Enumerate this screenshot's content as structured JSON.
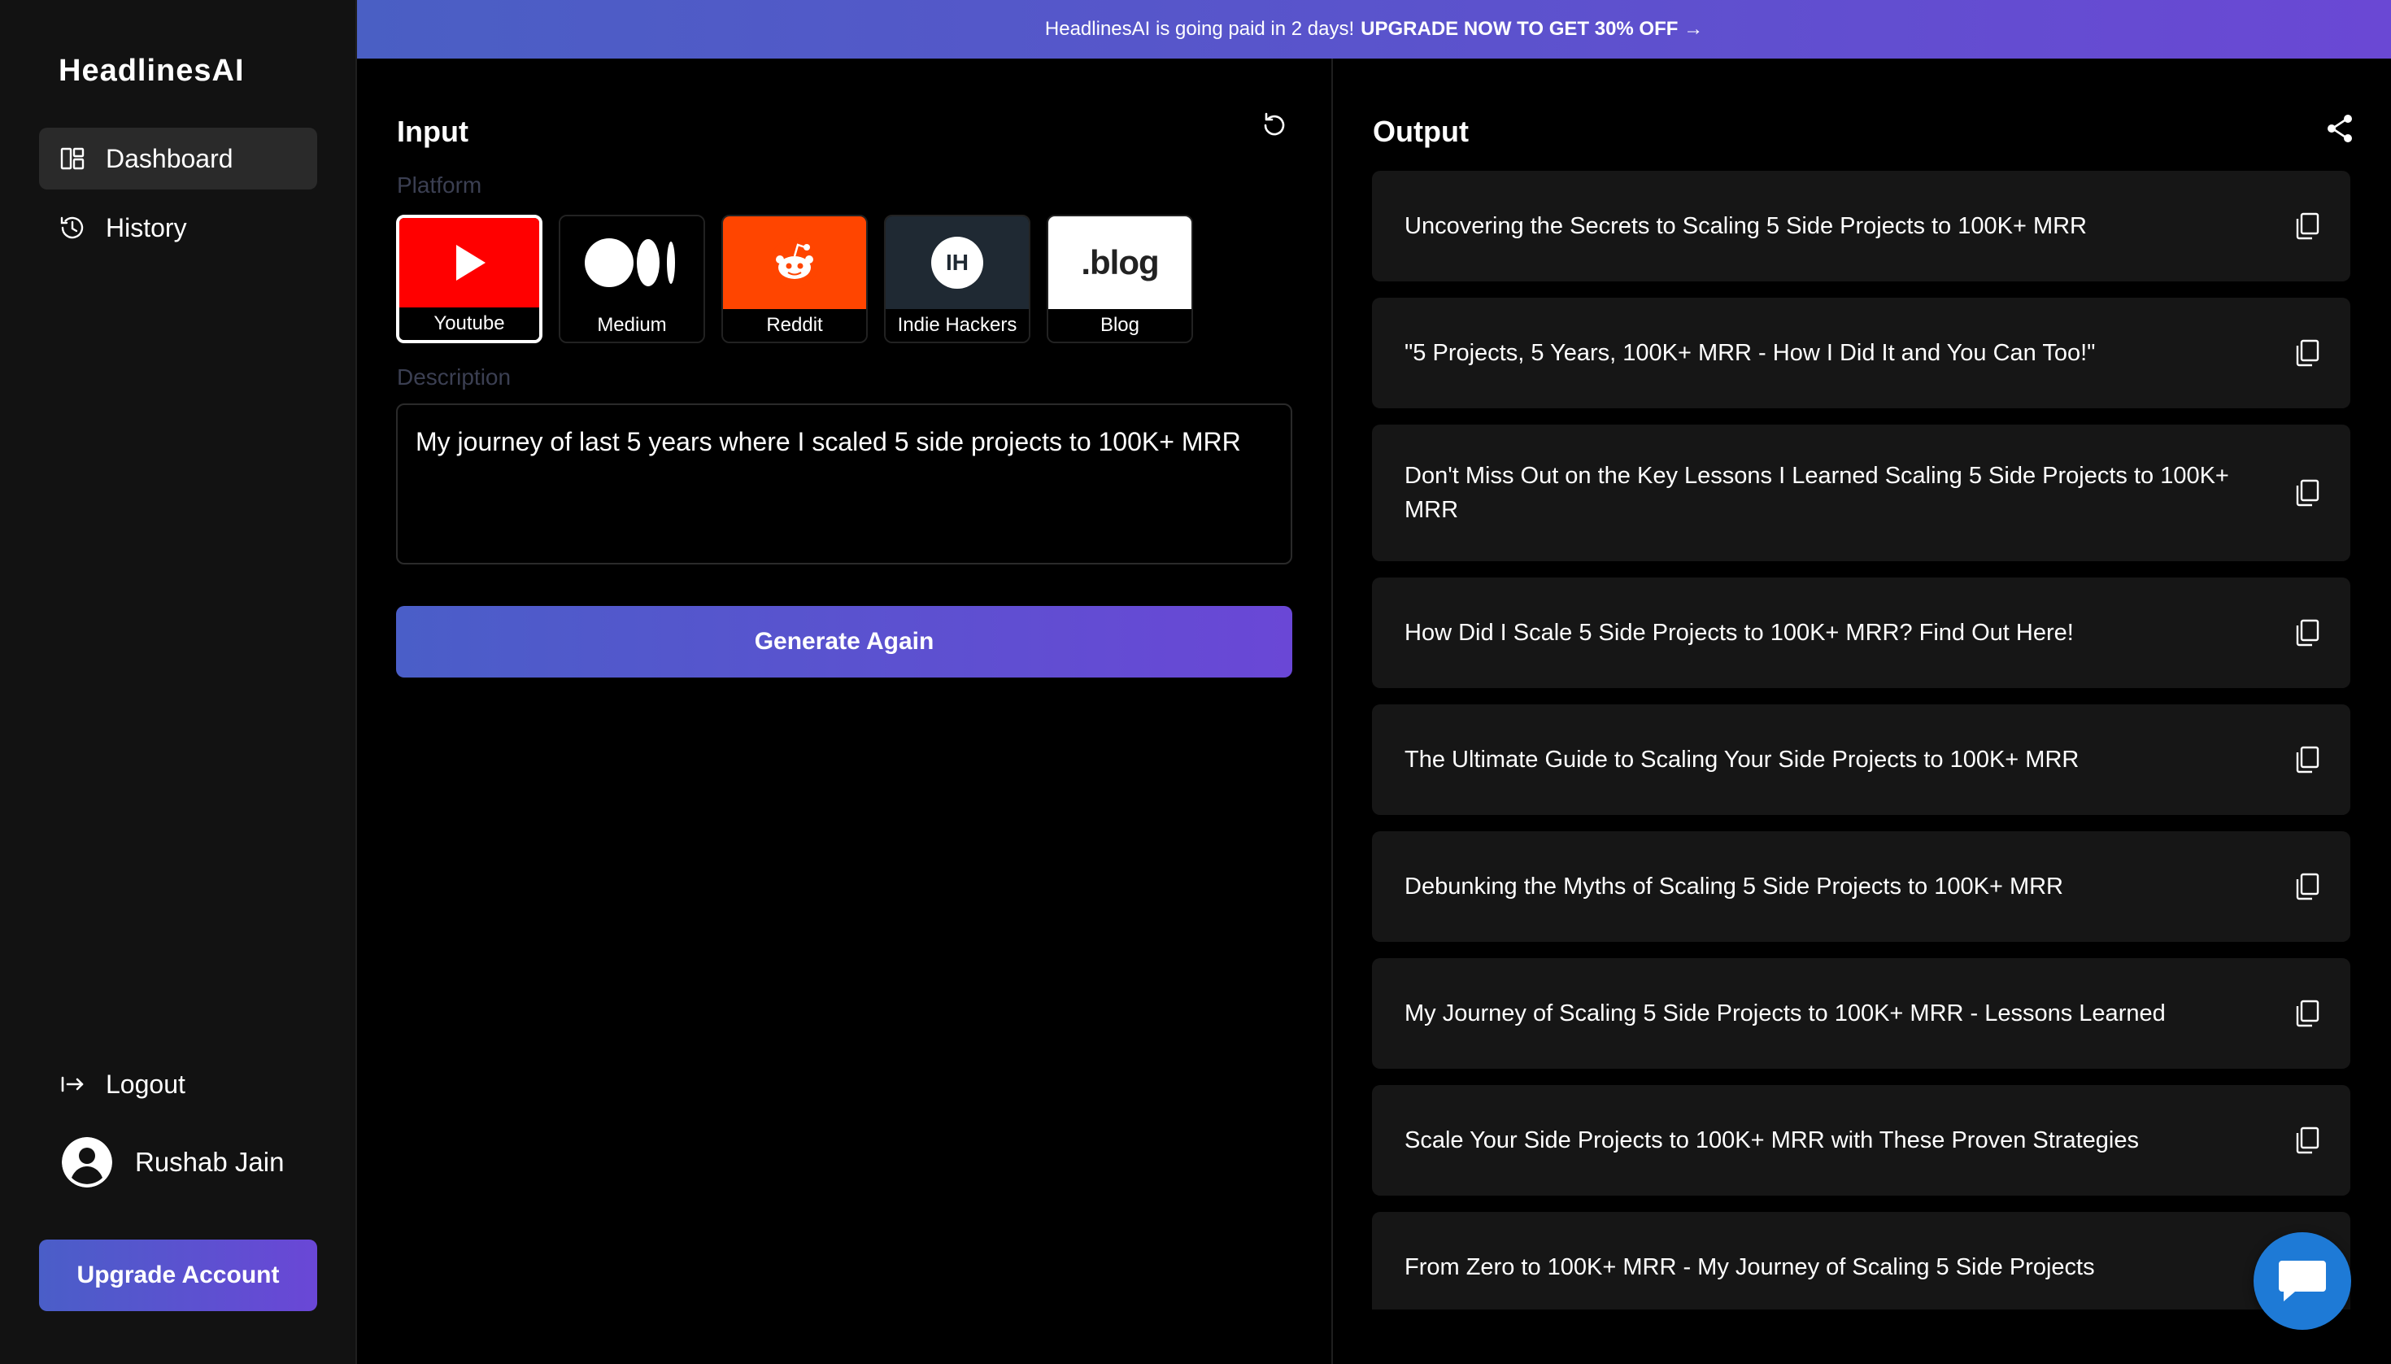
{
  "app": {
    "logo": "HeadlinesAI"
  },
  "sidebar": {
    "items": [
      {
        "label": "Dashboard",
        "icon": "dashboard-icon",
        "active": true
      },
      {
        "label": "History",
        "icon": "history-icon",
        "active": false
      }
    ],
    "logout_label": "Logout",
    "user_name": "Rushab Jain",
    "upgrade_label": "Upgrade Account"
  },
  "banner": {
    "text": "HeadlinesAI is going paid in 2 days!",
    "cta": "UPGRADE NOW TO GET 30% OFF →"
  },
  "input": {
    "title": "Input",
    "platform_label": "Platform",
    "platforms": [
      {
        "label": "Youtube",
        "selected": true,
        "color": "#ff0000"
      },
      {
        "label": "Medium",
        "selected": false,
        "color": "#000000"
      },
      {
        "label": "Reddit",
        "selected": false,
        "color": "#ff4500"
      },
      {
        "label": "Indie Hackers",
        "selected": false,
        "color": "#1f2933"
      },
      {
        "label": "Blog",
        "selected": false,
        "color": "#ffffff"
      }
    ],
    "indie_hackers_mark": "IH",
    "blog_mark": ".blog",
    "description_label": "Description",
    "description_value": "My journey of last 5 years where I scaled 5 side projects to 100K+ MRR",
    "generate_label": "Generate Again"
  },
  "output": {
    "title": "Output",
    "headlines": [
      "Uncovering the Secrets to Scaling 5 Side Projects to 100K+ MRR",
      "\"5 Projects, 5 Years, 100K+ MRR - How I Did It and You Can Too!\"",
      "Don't Miss Out on the Key Lessons I Learned Scaling 5 Side Projects to 100K+ MRR",
      "How Did I Scale 5 Side Projects to 100K+ MRR? Find Out Here!",
      "The Ultimate Guide to Scaling Your Side Projects to 100K+ MRR",
      "Debunking the Myths of Scaling 5 Side Projects to 100K+ MRR",
      "My Journey of Scaling 5 Side Projects to 100K+ MRR - Lessons Learned",
      "Scale Your Side Projects to 100K+ MRR with These Proven Strategies",
      "From Zero to 100K+ MRR - My Journey of Scaling 5 Side Projects"
    ]
  },
  "colors": {
    "accent_start": "#4a5ec8",
    "accent_end": "#6a47d6",
    "chat_fab": "#1e7ad6"
  }
}
